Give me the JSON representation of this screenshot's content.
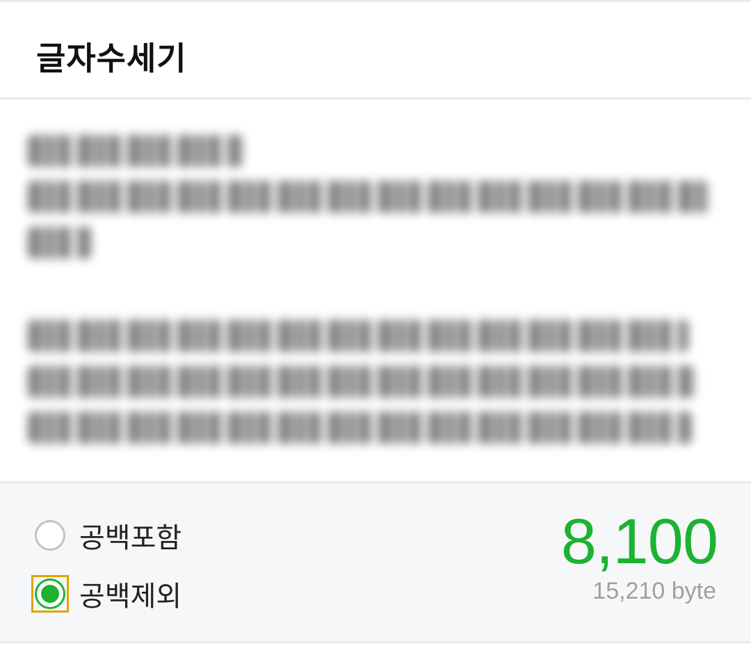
{
  "header": {
    "title": "글자수세기"
  },
  "editor": {
    "content": "[blurred text content]"
  },
  "options": [
    {
      "label": "공백포함",
      "selected": false
    },
    {
      "label": "공백제외",
      "selected": true
    }
  ],
  "result": {
    "count": "8,100",
    "bytes": "15,210 byte"
  },
  "colors": {
    "accent": "#1db232",
    "focus_outline": "#e0a200",
    "footer_bg": "#f5f7f9",
    "divider": "#e6ebf0"
  }
}
